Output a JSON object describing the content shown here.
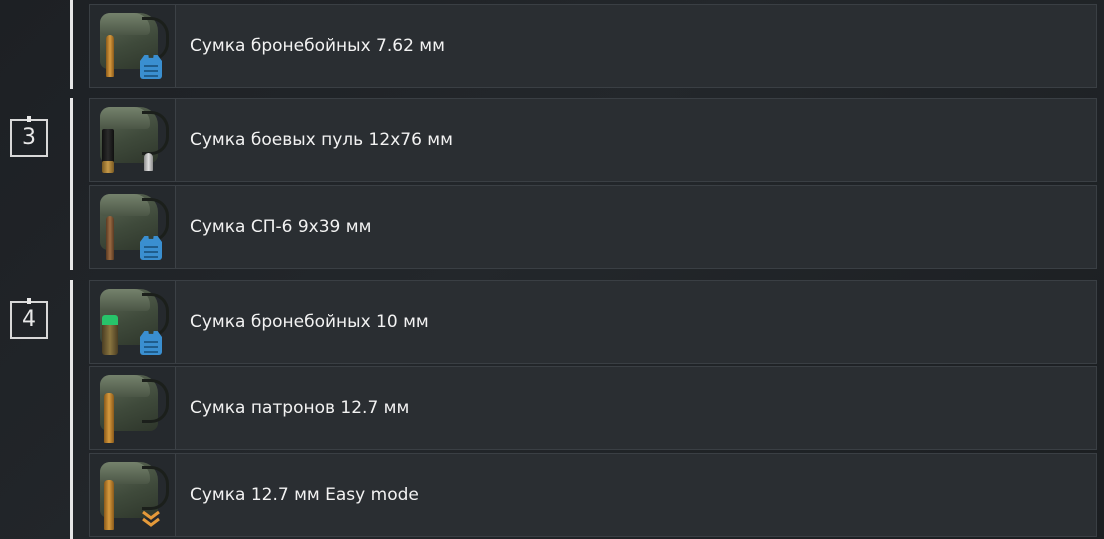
{
  "tiers": [
    {
      "id": "tier-2",
      "badge": "",
      "items": [
        {
          "name": "Сумка бронебойных 7.62 мм",
          "icon": "bag-armor-piercing-7.62-icon",
          "overlay": "armor-vest-icon"
        }
      ]
    },
    {
      "id": "tier-3",
      "badge": "3",
      "items": [
        {
          "name": "Сумка боевых пуль 12х76 мм",
          "icon": "bag-combat-bullets-12x76-icon",
          "overlay": ""
        },
        {
          "name": "Сумка СП-6 9х39 мм",
          "icon": "bag-sp6-9x39-icon",
          "overlay": "armor-vest-icon"
        }
      ]
    },
    {
      "id": "tier-4",
      "badge": "4",
      "items": [
        {
          "name": "Сумка бронебойных 10 мм",
          "icon": "bag-armor-piercing-10mm-icon",
          "overlay": "armor-vest-icon"
        },
        {
          "name": "Сумка патронов 12.7 мм",
          "icon": "bag-ammo-12.7-icon",
          "overlay": ""
        },
        {
          "name": "Сумка 12.7 мм Easy mode",
          "icon": "bag-12.7-easy-mode-icon",
          "overlay": "double-chevron-icon"
        }
      ]
    }
  ],
  "colors": {
    "background": "#1f2226",
    "row": "#2a2e32",
    "text": "#f2f2f2",
    "bracket": "#e6e6e6",
    "armor_overlay": "#3a8fd0",
    "chevron_overlay": "#e59a3a"
  }
}
